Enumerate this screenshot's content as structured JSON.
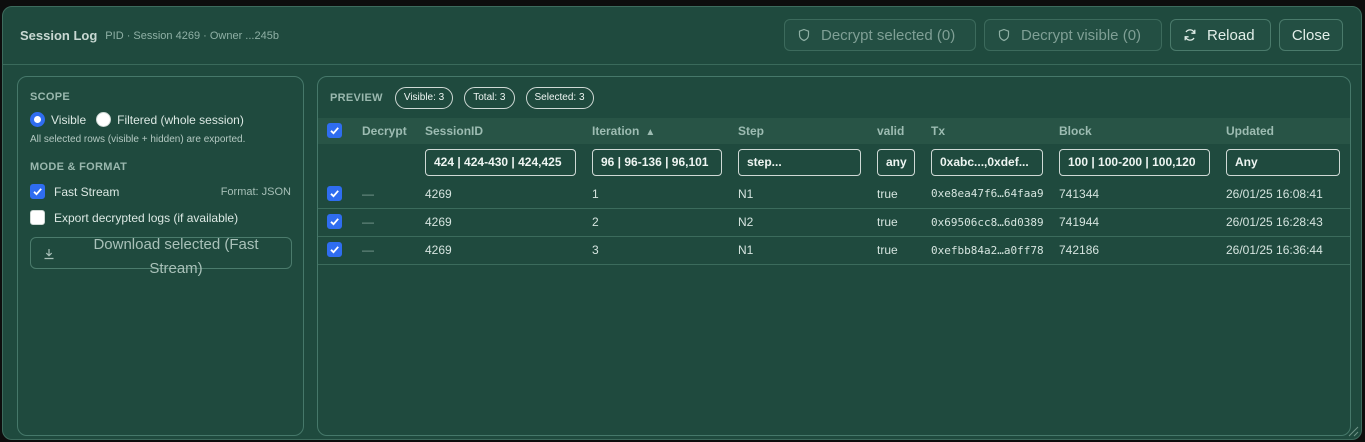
{
  "header": {
    "title": "Session Log",
    "subtitle": "PID · Session 4269 · Owner ...245b",
    "decrypt_selected": "Decrypt selected (0)",
    "decrypt_visible": "Decrypt visible (0)",
    "reload": "Reload",
    "close": "Close"
  },
  "scope": {
    "title": "SCOPE",
    "options": [
      "Visible",
      "Filtered (whole session)"
    ],
    "selected": "Visible",
    "note": "All selected rows (visible + hidden) are exported."
  },
  "mode": {
    "title": "MODE & FORMAT",
    "fast_stream": "Fast Stream",
    "fast_stream_checked": true,
    "format": "Format: JSON",
    "export_decrypted": "Export decrypted logs (if available)",
    "export_decrypted_checked": false,
    "download": "Download selected (Fast Stream)"
  },
  "preview": {
    "title": "PREVIEW",
    "visible": "Visible: 3",
    "total": "Total: 3",
    "selected": "Selected: 3"
  },
  "table": {
    "columns": {
      "decrypt": "Decrypt",
      "session": "SessionID",
      "iteration": "Iteration",
      "step": "Step",
      "valid": "valid",
      "tx": "Tx",
      "block": "Block",
      "updated": "Updated"
    },
    "filters": {
      "session": "424 | 424-430 | 424,425",
      "iteration": "96 | 96-136 | 96,101",
      "step": "step...",
      "valid": "any",
      "tx": "0xabc...,0xdef...",
      "block": "100 | 100-200 | 100,120",
      "updated": "Any"
    },
    "rows": [
      {
        "checked": true,
        "decrypt": "—",
        "session": "4269",
        "iteration": "1",
        "step": "N1",
        "valid": "true",
        "tx": "0xe8ea47f6…64faa9",
        "block": "741344",
        "updated": "26/01/25 16:08:41"
      },
      {
        "checked": true,
        "decrypt": "—",
        "session": "4269",
        "iteration": "2",
        "step": "N2",
        "valid": "true",
        "tx": "0x69506cc8…6d0389",
        "block": "741944",
        "updated": "26/01/25 16:28:43"
      },
      {
        "checked": true,
        "decrypt": "—",
        "session": "4269",
        "iteration": "3",
        "step": "N1",
        "valid": "true",
        "tx": "0xefbb84a2…a0ff78",
        "block": "742186",
        "updated": "26/01/25 16:36:44"
      }
    ]
  }
}
